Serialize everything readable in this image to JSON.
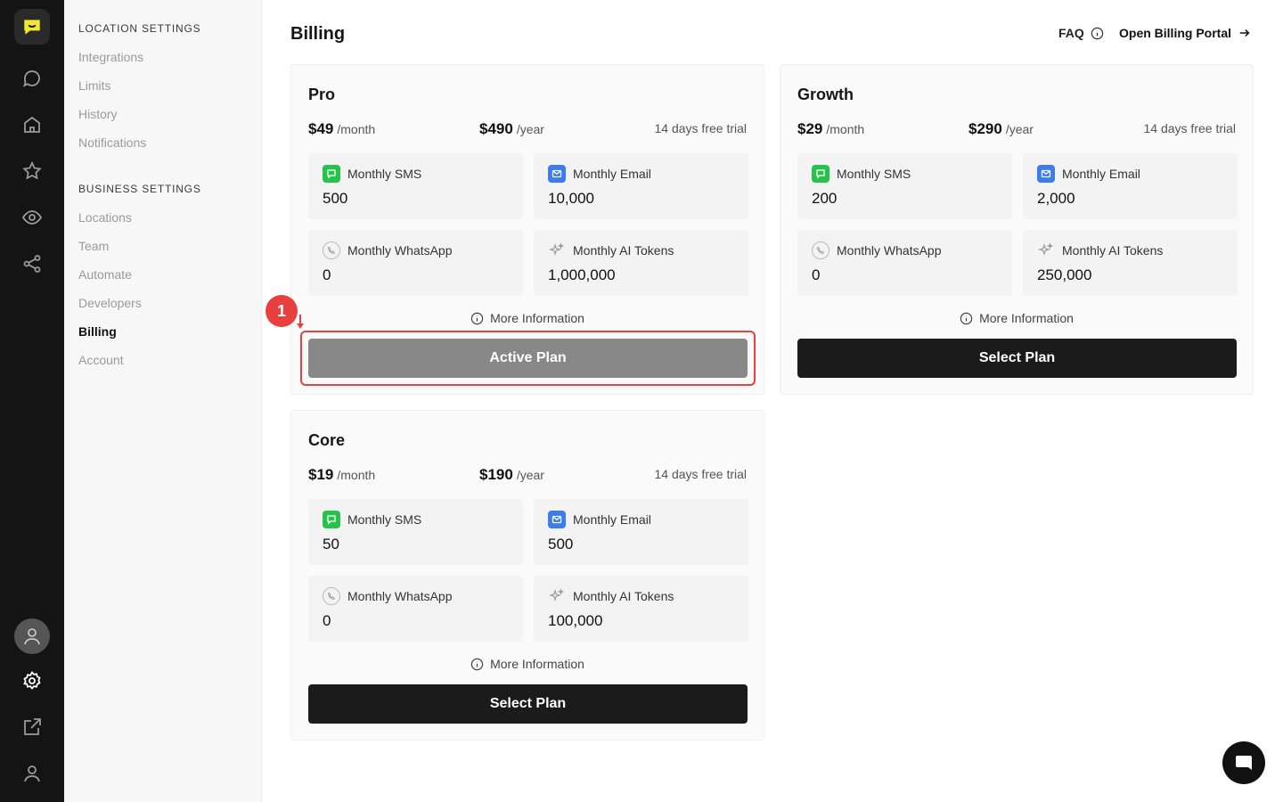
{
  "rail": {
    "items": [
      {
        "name": "messages-icon"
      },
      {
        "name": "home-icon"
      },
      {
        "name": "star-icon"
      },
      {
        "name": "eye-icon"
      },
      {
        "name": "share-icon"
      }
    ],
    "bottom": [
      {
        "name": "settings-icon"
      },
      {
        "name": "external-link-icon"
      },
      {
        "name": "user-icon"
      }
    ],
    "accent": "#f5e633"
  },
  "settings_nav": {
    "location_heading": "LOCATION SETTINGS",
    "location_items": [
      "Integrations",
      "Limits",
      "History",
      "Notifications"
    ],
    "business_heading": "BUSINESS SETTINGS",
    "business_items": [
      "Locations",
      "Team",
      "Automate",
      "Developers",
      "Billing",
      "Account"
    ],
    "active": "Billing"
  },
  "header": {
    "title": "Billing",
    "faq": "FAQ",
    "portal": "Open Billing Portal"
  },
  "plans": [
    {
      "name": "Pro",
      "monthly_price": "$49",
      "monthly_unit": "/month",
      "yearly_price": "$490",
      "yearly_unit": "/year",
      "trial": "14 days free trial",
      "features": [
        {
          "label": "Monthly SMS",
          "value": "500",
          "icon": "sms-icon"
        },
        {
          "label": "Monthly Email",
          "value": "10,000",
          "icon": "email-icon"
        },
        {
          "label": "Monthly WhatsApp",
          "value": "0",
          "icon": "whatsapp-icon"
        },
        {
          "label": "Monthly AI Tokens",
          "value": "1,000,000",
          "icon": "sparkle-icon"
        }
      ],
      "more_info": "More Information",
      "button": "Active Plan",
      "active": true
    },
    {
      "name": "Growth",
      "monthly_price": "$29",
      "monthly_unit": "/month",
      "yearly_price": "$290",
      "yearly_unit": "/year",
      "trial": "14 days free trial",
      "features": [
        {
          "label": "Monthly SMS",
          "value": "200",
          "icon": "sms-icon"
        },
        {
          "label": "Monthly Email",
          "value": "2,000",
          "icon": "email-icon"
        },
        {
          "label": "Monthly WhatsApp",
          "value": "0",
          "icon": "whatsapp-icon"
        },
        {
          "label": "Monthly AI Tokens",
          "value": "250,000",
          "icon": "sparkle-icon"
        }
      ],
      "more_info": "More Information",
      "button": "Select Plan",
      "active": false
    },
    {
      "name": "Core",
      "monthly_price": "$19",
      "monthly_unit": "/month",
      "yearly_price": "$190",
      "yearly_unit": "/year",
      "trial": "14 days free trial",
      "features": [
        {
          "label": "Monthly SMS",
          "value": "50",
          "icon": "sms-icon"
        },
        {
          "label": "Monthly Email",
          "value": "500",
          "icon": "email-icon"
        },
        {
          "label": "Monthly WhatsApp",
          "value": "0",
          "icon": "whatsapp-icon"
        },
        {
          "label": "Monthly AI Tokens",
          "value": "100,000",
          "icon": "sparkle-icon"
        }
      ],
      "more_info": "More Information",
      "button": "Select Plan",
      "active": false
    }
  ],
  "annotation": {
    "badge": "1",
    "color": "#e8403f"
  },
  "colors": {
    "sms": "#27c24c",
    "email": "#3b7cf0",
    "button_dark": "#1b1b1b",
    "button_active": "#888888"
  }
}
